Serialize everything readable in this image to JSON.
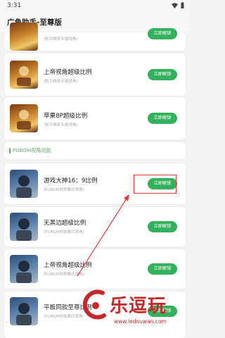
{
  "status_bar": {
    "time": "3:31",
    "wifi_icon": "wifi-icon",
    "battery_icon": "battery-icon"
  },
  "app": {
    "title": "广角助手-至尊版"
  },
  "top_card_partial": {
    "subtitle": "/和平精英专属视角/"
  },
  "items_top": [
    {
      "title": "上帝视角超级比例",
      "subtitle": "/和平精英专属视角/",
      "button": "立即解锁",
      "thumb": "hp-game-icon"
    },
    {
      "title": "苹果8P超级比例",
      "subtitle": "/和平精英专属视角/",
      "button": "立即解锁",
      "thumb": "hp-game-icon"
    }
  ],
  "section": {
    "label": "PUBGM视角功能"
  },
  "items_pubgm": [
    {
      "title": "游戏大神16：9比例",
      "subtitle": "/PUBGM地铁模式视角/",
      "button": "立即解锁",
      "thumb": "pubgm-game-icon"
    },
    {
      "title": "无黑边超级比例",
      "subtitle": "/PUBGM地铁模式视角/",
      "button": "立即解锁",
      "thumb": "pubgm-game-icon"
    },
    {
      "title": "上帝视角超级比例",
      "subtitle": "/PUBGM地铁模式视角/",
      "button": "立即解锁",
      "thumb": "pubgm-game-icon"
    },
    {
      "title": "平板同款至尊比例",
      "subtitle": "/PUBGM地铁模式视角/",
      "button": "立即解锁",
      "thumb": "pubgm-game-icon"
    }
  ],
  "top_button": "立即解锁",
  "watermark": {
    "text": "乐逗玩",
    "url": "www.ledouwan.com"
  },
  "colors": {
    "accent_green": "#34b15d",
    "section_green": "#6aa86f",
    "highlight_red": "#e23b3b"
  }
}
